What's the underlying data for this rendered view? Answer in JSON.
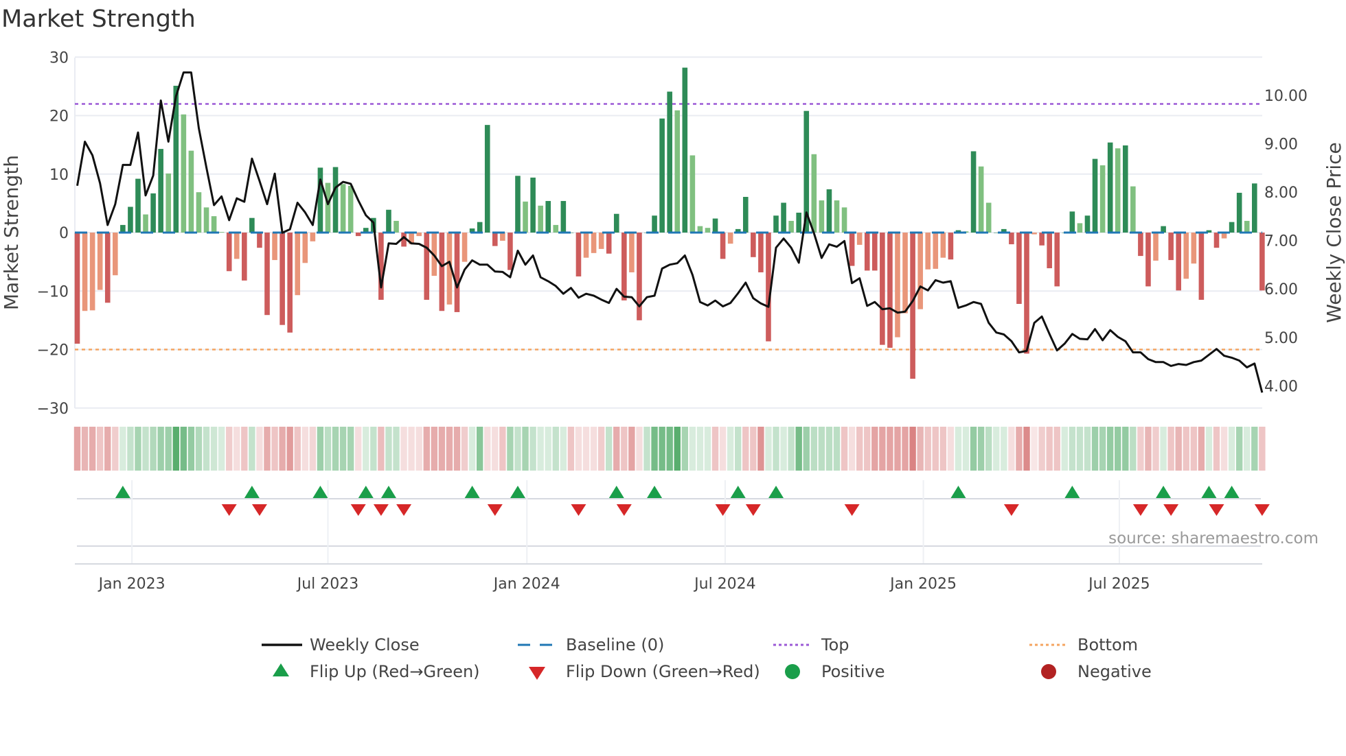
{
  "chart_data": {
    "type": "bar",
    "title": "Market Strength",
    "ylabel": "Market Strength",
    "ylabel_right": "Weekly Close Price",
    "ylim": [
      -30,
      30
    ],
    "ylim_right": [
      3.5,
      10.9
    ],
    "grid": true,
    "legend_placement": "bottom",
    "source": "source: sharemaestro.com",
    "yticks": [
      {
        "value": 30,
        "label": "30"
      },
      {
        "value": 20,
        "label": "20"
      },
      {
        "value": 10,
        "label": "10"
      },
      {
        "value": 0,
        "label": "0"
      },
      {
        "value": -10,
        "label": "−10"
      },
      {
        "value": -20,
        "label": "−20"
      },
      {
        "value": -30,
        "label": "−30"
      }
    ],
    "yticks_right": [
      {
        "value": 10,
        "label": "10.00"
      },
      {
        "value": 9,
        "label": "9.00"
      },
      {
        "value": 8,
        "label": "8.00"
      },
      {
        "value": 7,
        "label": "7.00"
      },
      {
        "value": 6,
        "label": "6.00"
      },
      {
        "value": 5,
        "label": "5.00"
      },
      {
        "value": 4,
        "label": "4.00"
      }
    ],
    "xticks": [
      {
        "week": 7.2,
        "label": "Jan 2023"
      },
      {
        "week": 33,
        "label": "Jul 2023"
      },
      {
        "week": 59.2,
        "label": "Jan 2024"
      },
      {
        "week": 85.3,
        "label": "Jul 2024"
      },
      {
        "week": 111.4,
        "label": "Jan 2025"
      },
      {
        "week": 137.2,
        "label": "Jul 2025"
      }
    ],
    "top_level": 22,
    "bottom_level": -20,
    "baseline": 0,
    "colors": {
      "pos_dark": "#2e8b57",
      "pos_light": "#80c080",
      "neg_dark": "#cd5c5c",
      "neg_light": "#e9967a",
      "price": "#111111",
      "baseline": "#1f77b4",
      "top": "#9b59d6",
      "bottom": "#f4a460",
      "flip_up": "#1a9e4a",
      "flip_down": "#d62728",
      "positive": "#1a9e4a",
      "negative": "#b22222",
      "heat_pos": "60,160,85",
      "heat_neg": "205,90,90"
    },
    "strength": [
      -19,
      -13.4,
      -13.3,
      -9.8,
      -12,
      -7.3,
      1.3,
      4.4,
      9.2,
      3.1,
      6.7,
      14.3,
      10.1,
      25.1,
      20.2,
      14,
      6.9,
      4.3,
      2.8,
      0.1,
      -6.6,
      -4.5,
      -8.2,
      2.5,
      -2.6,
      -14.1,
      -4.7,
      -15.8,
      -17.1,
      -10.7,
      -5.2,
      -1.5,
      11.1,
      8.5,
      11.2,
      8.3,
      8,
      -0.6,
      0.8,
      2.5,
      -11.5,
      3.9,
      2,
      -2.4,
      -2,
      -0.6,
      -11.5,
      -7.4,
      -13.4,
      -12.3,
      -13.6,
      -5,
      0.7,
      1.8,
      18.4,
      -2.3,
      -1.4,
      -6.4,
      9.7,
      5.3,
      9.4,
      4.6,
      5.4,
      1.3,
      5.4,
      0,
      -7.5,
      -4.3,
      -3.5,
      -2.8,
      -3.6,
      3.2,
      -11.6,
      -6.8,
      -15,
      0,
      2.9,
      19.5,
      24.1,
      20.9,
      28.2,
      13.2,
      1.1,
      0.8,
      2.4,
      -4.5,
      -1.9,
      0.6,
      6.1,
      -4.2,
      -6.8,
      -18.6,
      2.9,
      5.1,
      2,
      3.4,
      20.8,
      13.4,
      5.5,
      7.4,
      5.5,
      4.3,
      -5.7,
      -2.1,
      -6.5,
      -6.5,
      -19.2,
      -19.7,
      -17.9,
      -13.8,
      -25,
      -13.1,
      -6.3,
      -6.2,
      -4.3,
      -4.6,
      0.4,
      0.2,
      13.9,
      11.3,
      5.1,
      0,
      0.6,
      -2,
      -12.2,
      -20.7,
      -0.3,
      -2.2,
      -6.1,
      -9.2,
      0,
      3.6,
      1.6,
      2.9,
      12.6,
      11.5,
      15.4,
      14.4,
      14.9,
      7.9,
      -4,
      -9.2,
      -4.8,
      1.1,
      -4.7,
      -9.9,
      -7.9,
      -5.3,
      -11.5,
      0.4,
      -2.6,
      -1,
      1.8,
      6.8,
      2,
      8.4,
      -9.9
    ],
    "strength_dark": [
      1,
      0,
      0,
      0,
      1,
      0,
      1,
      1,
      1,
      0,
      1,
      1,
      0,
      1,
      0,
      0,
      0,
      0,
      0,
      0,
      1,
      0,
      1,
      1,
      1,
      1,
      0,
      1,
      1,
      0,
      0,
      0,
      1,
      0,
      1,
      0,
      0,
      1,
      1,
      1,
      1,
      1,
      0,
      1,
      0,
      0,
      1,
      0,
      1,
      0,
      1,
      0,
      1,
      1,
      1,
      1,
      0,
      1,
      1,
      0,
      1,
      0,
      1,
      0,
      1,
      1,
      1,
      0,
      0,
      0,
      1,
      1,
      1,
      0,
      1,
      1,
      1,
      1,
      1,
      0,
      1,
      0,
      0,
      0,
      1,
      1,
      0,
      1,
      1,
      1,
      1,
      1,
      1,
      1,
      0,
      1,
      1,
      0,
      0,
      1,
      0,
      0,
      1,
      0,
      1,
      1,
      1,
      1,
      0,
      0,
      1,
      0,
      0,
      0,
      0,
      1,
      1,
      0,
      1,
      0,
      0,
      1,
      1,
      1,
      1,
      1,
      0,
      1,
      1,
      1,
      1,
      1,
      0,
      1,
      1,
      0,
      1,
      0,
      1,
      0,
      1,
      1,
      0,
      1,
      1,
      1,
      0,
      0,
      1,
      1,
      1,
      0,
      1,
      1,
      0,
      1,
      1
    ],
    "weekly_close": [
      8.13,
      9.04,
      8.76,
      8.18,
      7.32,
      7.75,
      8.56,
      8.56,
      9.23,
      7.93,
      8.34,
      9.89,
      9.04,
      9.98,
      10.47,
      10.47,
      9.32,
      8.51,
      7.73,
      7.91,
      7.42,
      7.87,
      7.8,
      8.69,
      8.23,
      7.75,
      8.38,
      7.16,
      7.23,
      7.78,
      7.58,
      7.32,
      8.26,
      7.75,
      8.09,
      8.21,
      8.17,
      7.83,
      7.52,
      7.37,
      6.03,
      6.94,
      6.93,
      7.07,
      6.94,
      6.93,
      6.85,
      6.69,
      6.47,
      6.56,
      6.03,
      6.4,
      6.59,
      6.5,
      6.5,
      6.36,
      6.35,
      6.24,
      6.79,
      6.5,
      6.69,
      6.24,
      6.16,
      6.06,
      5.9,
      6.02,
      5.82,
      5.9,
      5.86,
      5.78,
      5.71,
      6.0,
      5.84,
      5.83,
      5.64,
      5.83,
      5.86,
      6.42,
      6.5,
      6.53,
      6.69,
      6.29,
      5.73,
      5.66,
      5.76,
      5.64,
      5.71,
      5.91,
      6.13,
      5.81,
      5.7,
      5.63,
      6.85,
      7.04,
      6.85,
      6.54,
      7.58,
      7.15,
      6.64,
      6.92,
      6.87,
      6.99,
      6.12,
      6.22,
      5.65,
      5.73,
      5.58,
      5.6,
      5.51,
      5.53,
      5.75,
      6.05,
      5.97,
      6.18,
      6.13,
      6.16,
      5.61,
      5.66,
      5.73,
      5.69,
      5.3,
      5.1,
      5.06,
      4.92,
      4.69,
      4.72,
      5.3,
      5.43,
      5.07,
      4.73,
      4.87,
      5.07,
      4.97,
      4.96,
      5.17,
      4.94,
      5.15,
      5.01,
      4.92,
      4.69,
      4.69,
      4.55,
      4.49,
      4.49,
      4.41,
      4.45,
      4.43,
      4.49,
      4.52,
      4.64,
      4.76,
      4.62,
      4.58,
      4.52,
      4.38,
      4.46,
      3.86
    ],
    "heat": [
      -0.55,
      -0.45,
      -0.5,
      -0.35,
      -0.5,
      -0.3,
      0.2,
      0.3,
      0.45,
      0.3,
      0.4,
      0.5,
      0.5,
      0.85,
      0.7,
      0.55,
      0.4,
      0.3,
      0.25,
      0.2,
      -0.3,
      -0.2,
      -0.35,
      0.3,
      -0.2,
      -0.5,
      -0.35,
      -0.5,
      -0.6,
      -0.35,
      -0.2,
      -0.25,
      0.5,
      0.35,
      0.45,
      0.45,
      0.45,
      -0.2,
      0.2,
      0.3,
      -0.4,
      0.3,
      0.3,
      -0.2,
      -0.2,
      -0.2,
      -0.5,
      -0.5,
      -0.5,
      -0.5,
      -0.5,
      -0.3,
      0.2,
      0.6,
      -0.2,
      -0.2,
      -0.35,
      0.45,
      0.3,
      0.45,
      0.3,
      0.2,
      0.2,
      0.3,
      0.2,
      -0.35,
      -0.2,
      -0.2,
      -0.2,
      -0.3,
      0.3,
      -0.5,
      -0.35,
      -0.55,
      -0.2,
      0.3,
      0.7,
      0.7,
      0.7,
      0.85,
      0.45,
      0.2,
      0.2,
      0.2,
      -0.35,
      -0.2,
      0.2,
      0.3,
      -0.35,
      -0.35,
      -0.65,
      0.2,
      0.3,
      0.2,
      0.3,
      0.7,
      0.5,
      0.35,
      0.35,
      0.35,
      0.35,
      -0.35,
      -0.2,
      -0.35,
      -0.35,
      -0.55,
      -0.55,
      -0.55,
      -0.55,
      -0.55,
      -0.75,
      -0.45,
      -0.35,
      -0.35,
      -0.35,
      -0.2,
      0.2,
      0.2,
      0.55,
      0.5,
      0.35,
      0.2,
      0.2,
      -0.2,
      -0.5,
      -0.7,
      -0.15,
      -0.3,
      -0.35,
      -0.35,
      0.2,
      0.3,
      0.3,
      0.3,
      0.5,
      0.45,
      0.55,
      0.55,
      0.55,
      0.35,
      -0.3,
      -0.45,
      -0.3,
      0.2,
      -0.35,
      -0.45,
      -0.35,
      -0.35,
      -0.5,
      0.2,
      -0.35,
      -0.2,
      0.2,
      0.45,
      0.2,
      0.45,
      -0.35
    ],
    "flip_up_weeks": [
      6,
      23,
      32,
      38,
      41,
      52,
      58,
      71,
      76,
      87,
      92,
      116,
      131,
      143,
      149,
      152
    ],
    "flip_down_weeks": [
      20,
      24,
      37,
      40,
      43,
      55,
      66,
      72,
      85,
      89,
      102,
      123,
      140,
      144,
      150,
      156
    ],
    "legend": [
      {
        "key": "weekly_close",
        "label": "Weekly Close",
        "symbol": "line"
      },
      {
        "key": "baseline",
        "label": "Baseline (0)",
        "symbol": "dash"
      },
      {
        "key": "top",
        "label": "Top",
        "symbol": "dot"
      },
      {
        "key": "bottom",
        "label": "Bottom",
        "symbol": "dot"
      },
      {
        "key": "flip_up",
        "label": "Flip Up (Red→Green)",
        "symbol": "triangle-up"
      },
      {
        "key": "flip_down",
        "label": "Flip Down (Green→Red)",
        "symbol": "triangle-down"
      },
      {
        "key": "positive",
        "label": "Positive",
        "symbol": "circle"
      },
      {
        "key": "negative",
        "label": "Negative",
        "symbol": "circle"
      }
    ]
  }
}
